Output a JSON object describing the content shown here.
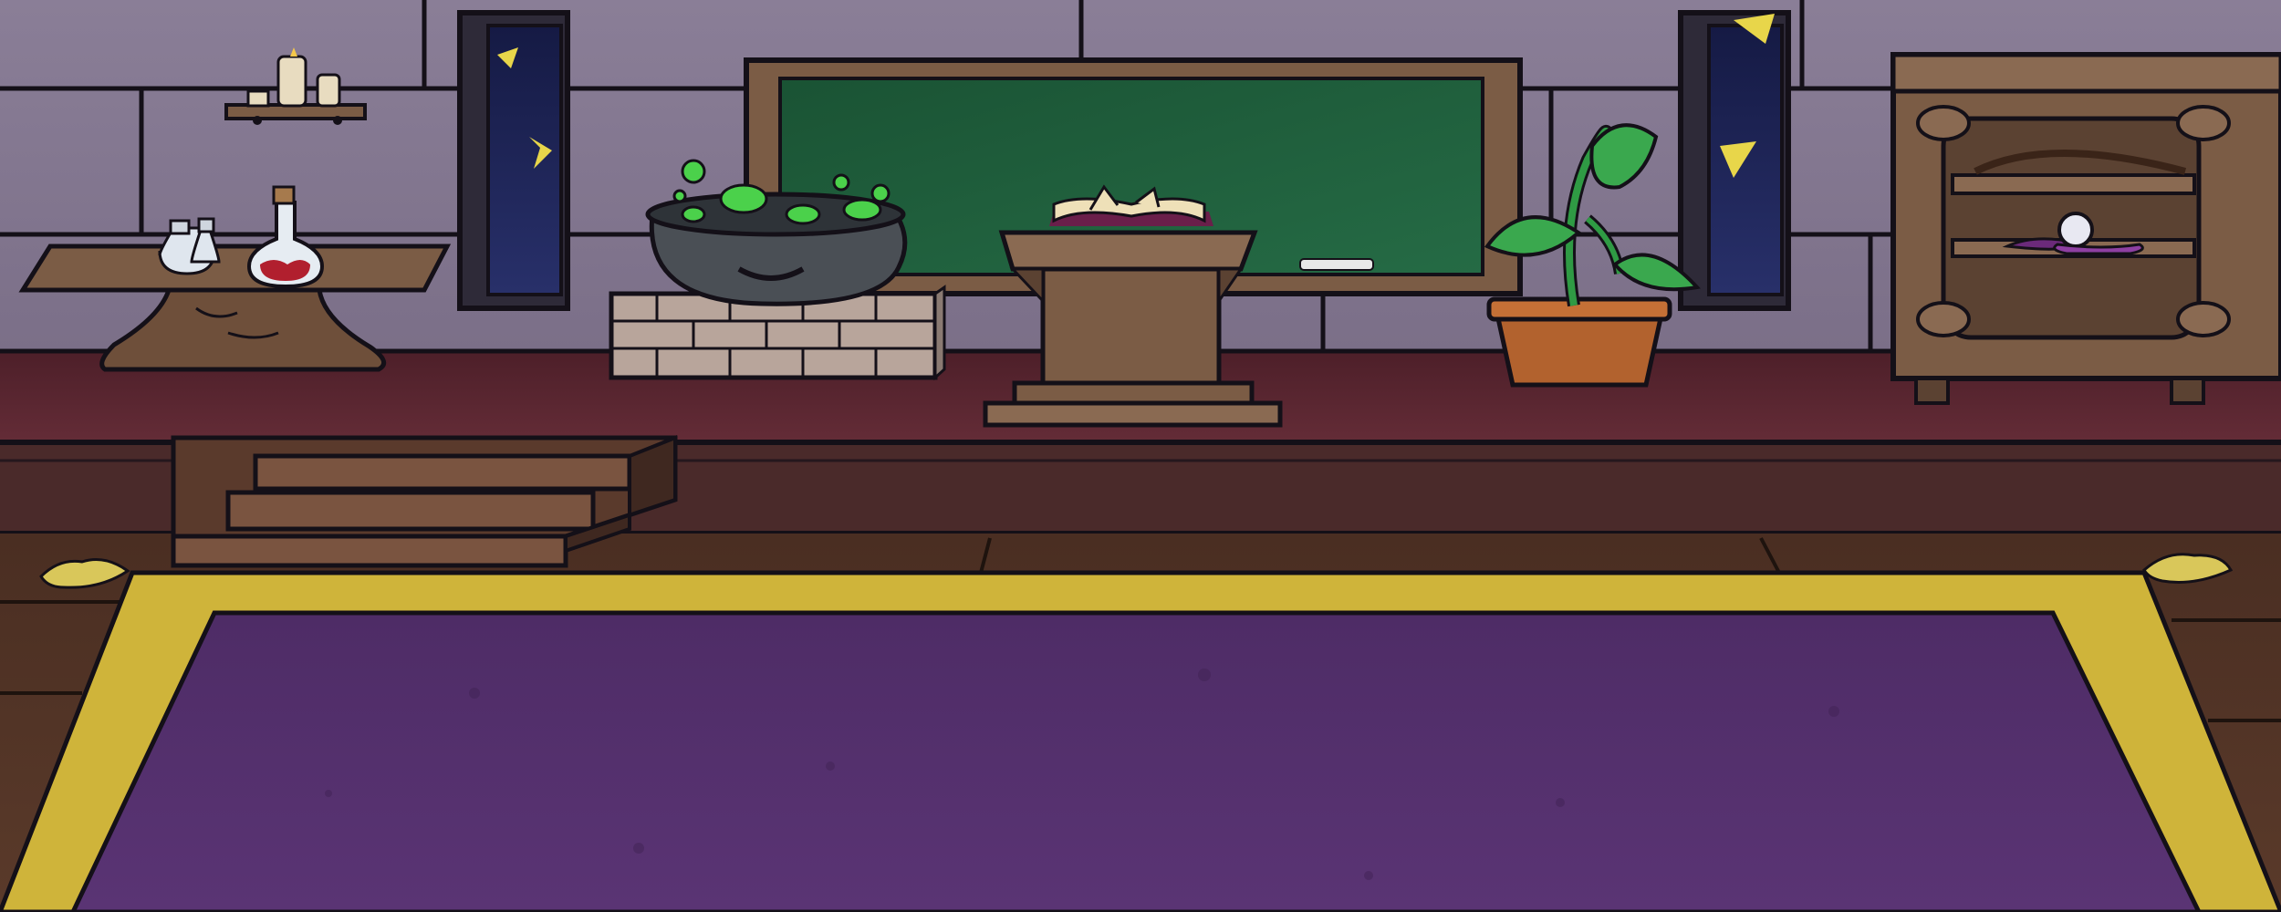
{
  "scene": {
    "type": "game-background",
    "room": "classroom",
    "objects": [
      {
        "id": "candle-shelf",
        "icon": "candle-icon"
      },
      {
        "id": "potion-table",
        "icon": "potion-icon"
      },
      {
        "id": "window-left",
        "icon": "window-icon"
      },
      {
        "id": "cauldron",
        "icon": "cauldron-icon"
      },
      {
        "id": "chalkboard",
        "icon": "chalkboard-icon"
      },
      {
        "id": "lectern",
        "icon": "book-icon"
      },
      {
        "id": "potted-plant",
        "icon": "plant-icon"
      },
      {
        "id": "window-right",
        "icon": "window-icon"
      },
      {
        "id": "cabinet",
        "icon": "cabinet-icon"
      },
      {
        "id": "crystal-ball",
        "icon": "crystal-ball-icon"
      },
      {
        "id": "stairs",
        "icon": "stairs-icon"
      },
      {
        "id": "purple-rug",
        "icon": "rug-icon"
      }
    ]
  },
  "colors": {
    "wall": "#847891",
    "mortar": "#141018",
    "stage": "#5b2530",
    "floor": "#4e3226",
    "rug_border": "#cfb43a",
    "rug": "#55306e",
    "board": "#1f5b3a",
    "wood": "#7b5c45",
    "goo": "#4bd14b",
    "night_sky": "#1e2456",
    "star": "#e8d64a"
  }
}
